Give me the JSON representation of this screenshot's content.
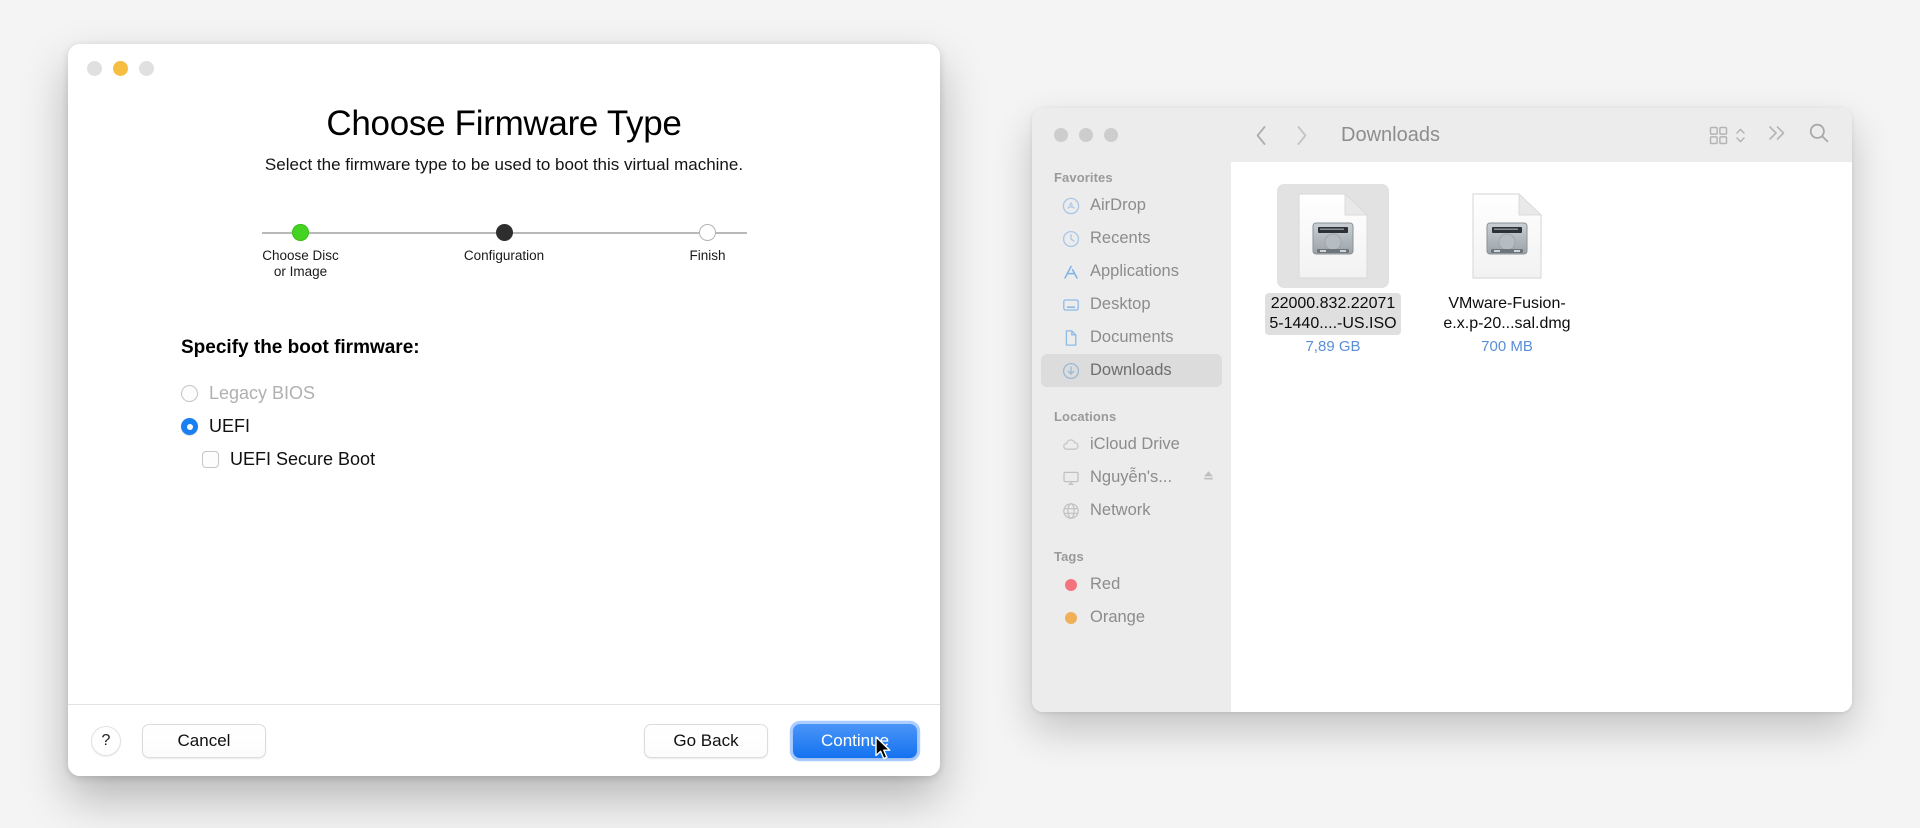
{
  "wizard": {
    "window_controls": [
      "close-disabled",
      "minimize",
      "zoom-disabled"
    ],
    "title": "Choose Firmware Type",
    "subtitle": "Select the firmware type to be used to boot this virtual machine.",
    "steps": [
      {
        "label": "Choose Disc\nor Image",
        "state": "done"
      },
      {
        "label": "Configuration",
        "state": "current"
      },
      {
        "label": "Finish",
        "state": "todo"
      }
    ],
    "section_heading": "Specify the boot firmware:",
    "options": [
      {
        "label": "Legacy BIOS",
        "type": "radio",
        "checked": false,
        "disabled": true
      },
      {
        "label": "UEFI",
        "type": "radio",
        "checked": true,
        "disabled": false
      },
      {
        "label": "UEFI Secure Boot",
        "type": "checkbox",
        "checked": false,
        "disabled": false
      }
    ],
    "footer": {
      "help_label": "?",
      "cancel_label": "Cancel",
      "go_back_label": "Go Back",
      "continue_label": "Continue",
      "primary_color": "#1472f0"
    }
  },
  "finder": {
    "path_title": "Downloads",
    "toolbar": {
      "back_icon": "chevron-left-icon",
      "forward_icon": "chevron-right-icon",
      "view_icon": "grid-view-icon",
      "view_chevrons_icon": "up-down-chevron-icon",
      "overflow_icon": "double-chevron-right-icon",
      "search_icon": "search-icon"
    },
    "sidebar": {
      "groups": [
        {
          "title": "Favorites",
          "items": [
            {
              "label": "AirDrop",
              "icon": "airdrop-icon",
              "selected": false
            },
            {
              "label": "Recents",
              "icon": "clock-icon",
              "selected": false
            },
            {
              "label": "Applications",
              "icon": "applications-icon",
              "selected": false
            },
            {
              "label": "Desktop",
              "icon": "desktop-icon",
              "selected": false
            },
            {
              "label": "Documents",
              "icon": "document-icon",
              "selected": false
            },
            {
              "label": "Downloads",
              "icon": "downloads-icon",
              "selected": true
            }
          ]
        },
        {
          "title": "Locations",
          "items": [
            {
              "label": "iCloud Drive",
              "icon": "cloud-icon",
              "selected": false
            },
            {
              "label": "Nguyễn's...",
              "icon": "display-icon",
              "selected": false,
              "eject": true
            },
            {
              "label": "Network",
              "icon": "globe-icon",
              "selected": false
            }
          ]
        },
        {
          "title": "Tags",
          "items": [
            {
              "label": "Red",
              "icon": "tag-dot-icon",
              "color": "#f4737f",
              "selected": false
            },
            {
              "label": "Orange",
              "icon": "tag-dot-icon",
              "color": "#f0b057",
              "selected": false
            }
          ]
        }
      ]
    },
    "files": [
      {
        "name": "22000.832.220715-1440....-US.ISO",
        "name_display": "22000.832.22071\n5-1440....-US.ISO",
        "size": "7,89 GB",
        "icon": "disk-image-document-icon",
        "selected": true
      },
      {
        "name": "VMware-Fusion-e.x.p-20...sal.dmg",
        "name_display": "VMware-Fusion-\ne.x.p-20...sal.dmg",
        "size": "700 MB",
        "icon": "disk-image-document-icon",
        "selected": false
      }
    ]
  }
}
